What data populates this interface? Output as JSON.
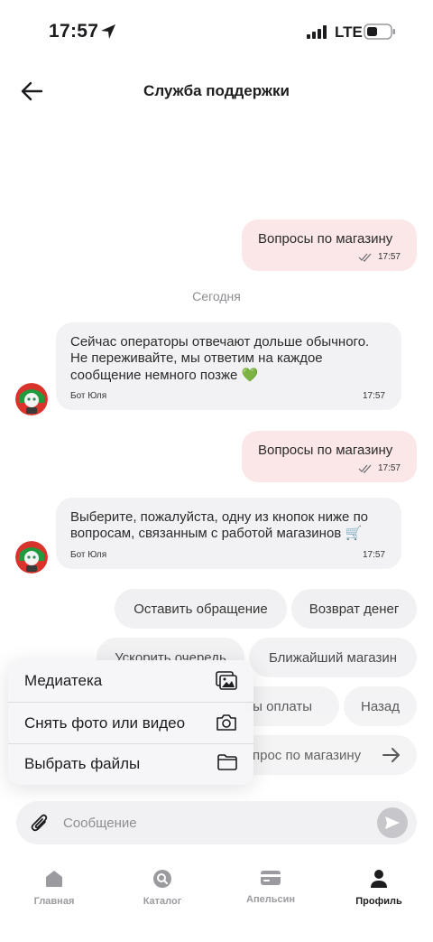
{
  "status_bar": {
    "time": "17:57",
    "network": "LTE"
  },
  "header": {
    "title": "Служба поддержки"
  },
  "messages": {
    "out1": {
      "text": "Вопросы по магазину",
      "time": "17:57"
    },
    "date_separator": "Сегодня",
    "in1": {
      "text": "Сейчас операторы отвечают дольше обычного. Не переживайте, мы ответим на каждое сообщение немного позже 💚",
      "sender": "Бот Юля",
      "time": "17:57"
    },
    "out2": {
      "text": "Вопросы по магазину",
      "time": "17:57"
    },
    "in2": {
      "text": "Выберите, пожалуйста, одну из кнопок ниже по вопросам, связанным с работой магазинов 🛒",
      "sender": "Бот Юля",
      "time": "17:57"
    }
  },
  "quick_replies": {
    "leave_request": "Оставить обращение",
    "refund": "Возврат денег",
    "speed_up_queue": "Ускорить очередь",
    "nearest_store": "Ближайший магазин",
    "payment_methods": "бы оплаты",
    "back": "Назад",
    "store_question": "прос по магазину"
  },
  "attach_menu": {
    "media_library": "Медиатека",
    "take_photo": "Снять фото или видео",
    "choose_files": "Выбрать файлы"
  },
  "input": {
    "placeholder": "Сообщение"
  },
  "tabs": [
    {
      "label": "Главная",
      "icon": "home-icon"
    },
    {
      "label": "Каталог",
      "icon": "catalog-search-icon"
    },
    {
      "label": "Апельсин",
      "icon": "card-icon"
    },
    {
      "label": "Профиль",
      "icon": "profile-icon"
    }
  ],
  "colors": {
    "outgoing_bubble": "#fbe7e8",
    "incoming_bubble": "#f2f2f4",
    "accent_green": "#2fb34a"
  }
}
